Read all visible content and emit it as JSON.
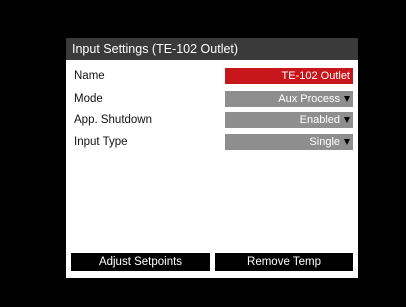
{
  "dialog": {
    "title": "Input Settings (TE-102 Outlet)"
  },
  "fields": [
    {
      "label": "Name",
      "value": "TE-102 Outlet",
      "kind": "text"
    },
    {
      "label": "Mode",
      "value": "Aux Process",
      "kind": "select"
    },
    {
      "label": "App. Shutdown",
      "value": "Enabled",
      "kind": "select"
    },
    {
      "label": "Input Type",
      "value": "Single",
      "kind": "select"
    }
  ],
  "buttons": {
    "adjust_setpoints": "Adjust Setpoints",
    "remove_temp": "Remove Temp"
  },
  "colors": {
    "title_bar": "#3a3a3a",
    "name_field": "#c8161d",
    "select_field": "#8e8e8e",
    "button": "#000000",
    "background": "#000000"
  },
  "icons": {
    "select_arrow": "chevron-down-icon"
  }
}
